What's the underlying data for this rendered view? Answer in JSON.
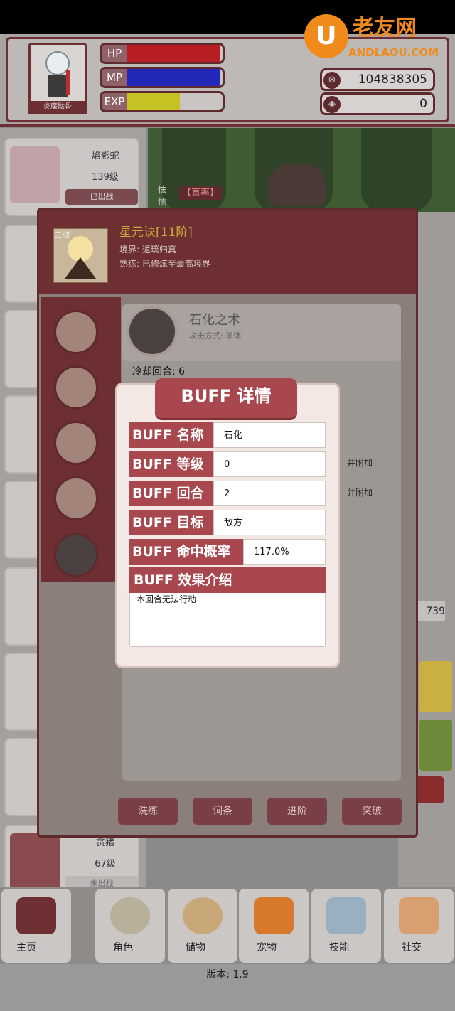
{
  "logo": {
    "mark": "U",
    "name": "老友网",
    "domain": "ANDLAOU.COM"
  },
  "player": {
    "name": "炎魔骷骨",
    "bars": [
      {
        "label": "HP",
        "fill": 0.98,
        "color": "#b81d22"
      },
      {
        "label": "MP",
        "fill": 0.98,
        "color": "#2228b8"
      },
      {
        "label": "EXP",
        "fill": 0.55,
        "color": "#c7c224"
      }
    ],
    "currencies": [
      {
        "icon": "coin-icon",
        "symbol": "⊗",
        "value": "104838305"
      },
      {
        "icon": "gem-icon",
        "symbol": "◈",
        "value": "0"
      }
    ]
  },
  "pets": [
    {
      "name": "焰影蛇",
      "level": "139级",
      "status": "已出战"
    },
    {
      "name": "贪猪",
      "level": "67级",
      "status": "未出战"
    }
  ],
  "scene": {
    "enemy_text": "怯\n懦",
    "tag": "【直率】"
  },
  "skill_panel": {
    "main_label": "主动",
    "title": "星元诀[11阶]",
    "realm": "境界: 返璞归真",
    "mastery": "熟练: 已修炼至最高境界",
    "skill_name": "石化之术",
    "attack_mode": "攻击方式: 单体",
    "cooldown": "冷却回合: 6",
    "buttons": [
      "洗练",
      "词条",
      "进阶",
      "突破"
    ]
  },
  "right_side": {
    "plus1": "并附加",
    "plus2": "并附加",
    "num": "739"
  },
  "buff_dialog": {
    "title": "BUFF 详情",
    "rows": [
      {
        "key": "BUFF 名称",
        "value": "石化"
      },
      {
        "key": "BUFF 等级",
        "value": "0"
      },
      {
        "key": "BUFF 回合",
        "value": "2"
      },
      {
        "key": "BUFF 目标",
        "value": "敌方"
      },
      {
        "key": "BUFF 命中概率",
        "value": "117.0%"
      }
    ],
    "effect_label": "BUFF 效果介绍",
    "effect_text": "本回合无法行动"
  },
  "nav": [
    {
      "label": "主页",
      "icon": "home-icon"
    },
    {
      "label": "角色",
      "icon": "character-icon"
    },
    {
      "label": "储物",
      "icon": "bag-icon"
    },
    {
      "label": "宠物",
      "icon": "pet-icon"
    },
    {
      "label": "技能",
      "icon": "sword-icon"
    },
    {
      "label": "社交",
      "icon": "handshake-icon"
    }
  ],
  "version": "版本: 1.9"
}
